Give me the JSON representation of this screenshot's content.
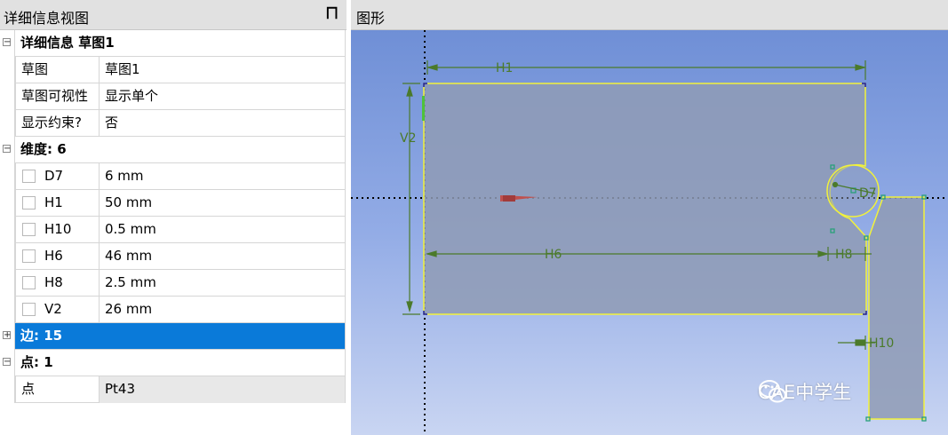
{
  "details": {
    "title": "详细信息视图",
    "pin_glyph": "ª",
    "sections": {
      "sketch": {
        "header": "详细信息 草图1",
        "rows": [
          {
            "name": "草图",
            "value": "草图1"
          },
          {
            "name": "草图可视性",
            "value": "显示单个"
          },
          {
            "name": "显示约束?",
            "value": "否"
          }
        ]
      },
      "dimensions": {
        "header": "维度: 6",
        "rows": [
          {
            "name": "D7",
            "value": "6 mm"
          },
          {
            "name": "H1",
            "value": "50 mm"
          },
          {
            "name": "H10",
            "value": "0.5 mm"
          },
          {
            "name": "H6",
            "value": "46 mm"
          },
          {
            "name": "H8",
            "value": "2.5 mm"
          },
          {
            "name": "V2",
            "value": "26 mm"
          }
        ]
      },
      "edges": {
        "header": "边: 15"
      },
      "points": {
        "header": "点: 1",
        "rows": [
          {
            "name": "点",
            "value": "Pt43"
          }
        ]
      }
    }
  },
  "graphics": {
    "title": "图形",
    "labels": {
      "h1": "H1",
      "v2": "V2",
      "h6": "H6",
      "h8": "H8",
      "d7": "D7",
      "h10": "H10"
    },
    "colors": {
      "sketch_line": "#f2f23a",
      "dimension": "#4b7a2a",
      "fill": "#8f9bb5",
      "selection": "#0a7ad9"
    }
  },
  "watermark": {
    "text": "CAE中学生",
    "icon": "wechat-icon"
  }
}
